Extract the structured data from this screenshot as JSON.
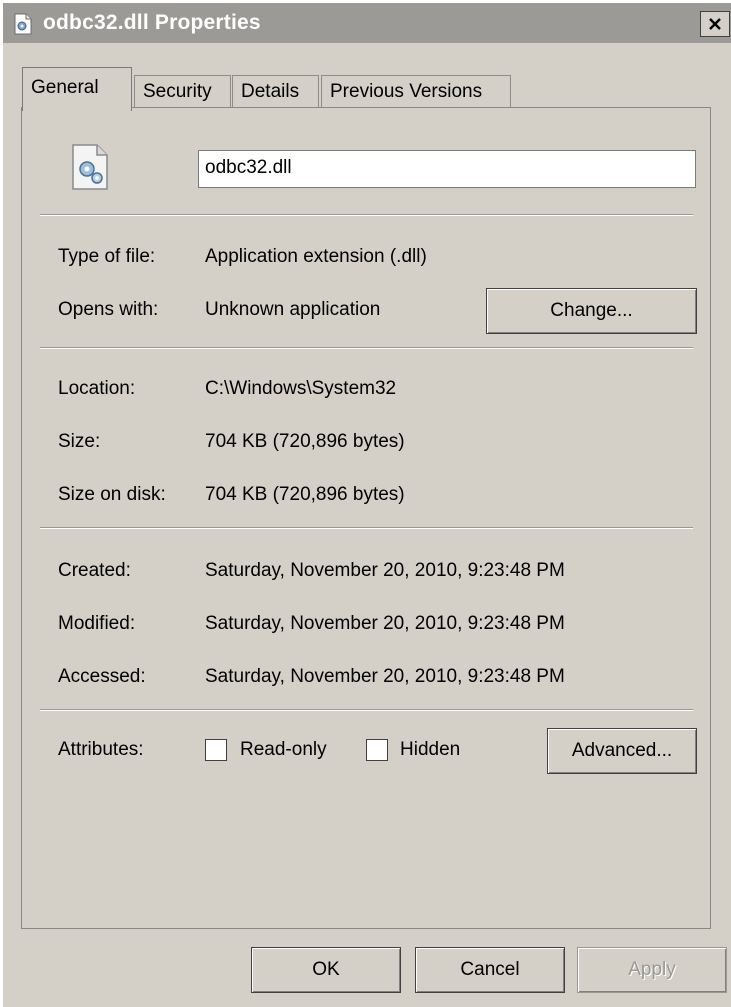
{
  "window": {
    "title": "odbc32.dll Properties",
    "icons": {
      "title": "dll-file-icon",
      "close": "close-icon",
      "file": "gear-document-icon"
    }
  },
  "tabs": [
    {
      "label": "General",
      "active": true
    },
    {
      "label": "Security",
      "active": false
    },
    {
      "label": "Details",
      "active": false
    },
    {
      "label": "Previous Versions",
      "active": false
    }
  ],
  "general": {
    "file_name": "odbc32.dll",
    "type_label": "Type of file:",
    "type_value": "Application extension (.dll)",
    "opens_label": "Opens with:",
    "opens_value": "Unknown application",
    "change_button": "Change...",
    "location_label": "Location:",
    "location_value": "C:\\Windows\\System32",
    "size_label": "Size:",
    "size_value": "704 KB (720,896 bytes)",
    "size_disk_label": "Size on disk:",
    "size_disk_value": "704 KB (720,896 bytes)",
    "created_label": "Created:",
    "created_value": "Saturday, November 20, 2010, 9:23:48 PM",
    "modified_label": "Modified:",
    "modified_value": "Saturday, November 20, 2010, 9:23:48 PM",
    "accessed_label": "Accessed:",
    "accessed_value": "Saturday, November 20, 2010, 9:23:48 PM",
    "attributes_label": "Attributes:",
    "readonly_label": "Read-only",
    "readonly_checked": false,
    "hidden_label": "Hidden",
    "hidden_checked": false,
    "advanced_button": "Advanced..."
  },
  "footer": {
    "ok": "OK",
    "cancel": "Cancel",
    "apply": "Apply",
    "apply_enabled": false
  }
}
